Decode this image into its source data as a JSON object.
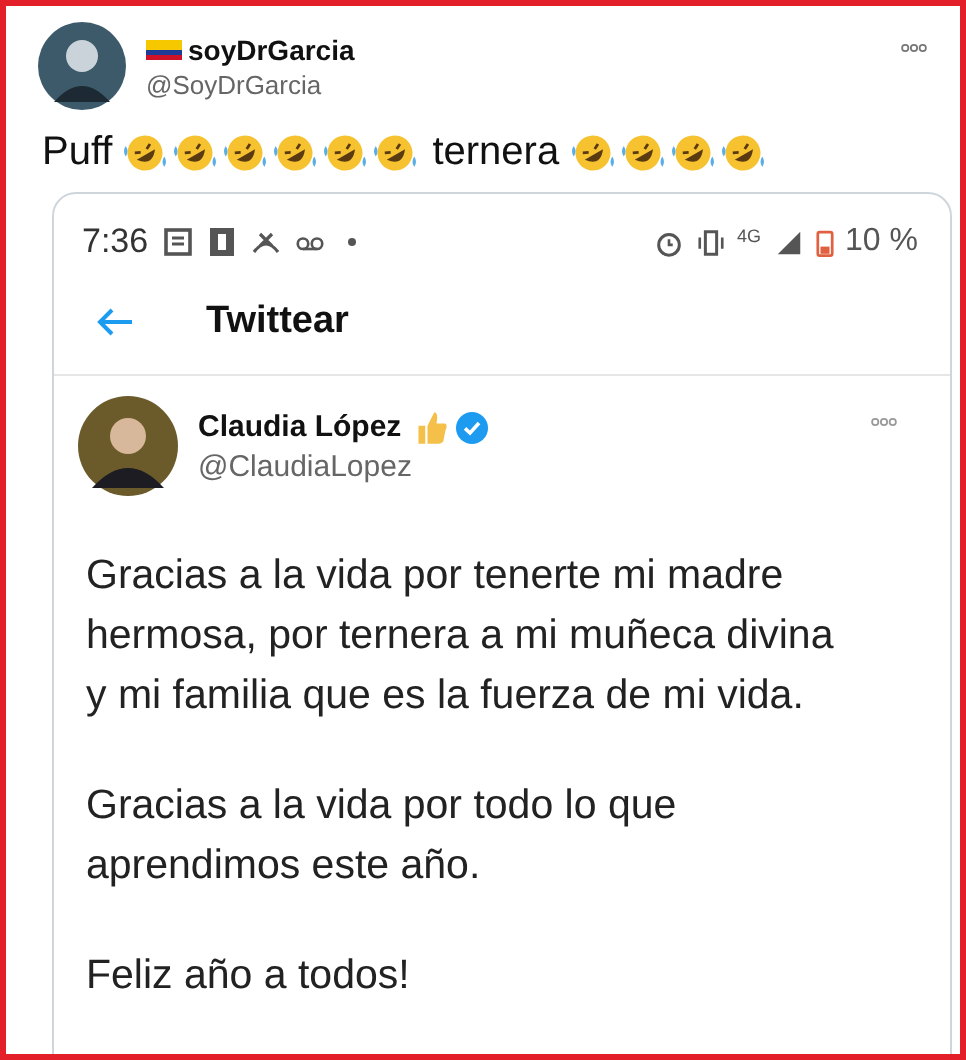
{
  "author": {
    "name": "soyDrGarcia",
    "handle": "@SoyDrGarcia"
  },
  "post_parts": [
    {
      "kind": "text",
      "text": "Puff"
    },
    {
      "kind": "emoji"
    },
    {
      "kind": "emoji"
    },
    {
      "kind": "emoji"
    },
    {
      "kind": "emoji"
    },
    {
      "kind": "emoji"
    },
    {
      "kind": "emoji"
    },
    {
      "kind": "text",
      "text": "ternera"
    },
    {
      "kind": "emoji"
    },
    {
      "kind": "emoji"
    },
    {
      "kind": "emoji"
    },
    {
      "kind": "emoji"
    }
  ],
  "screenshot": {
    "status_bar": {
      "time": "7:36",
      "battery": "10 %",
      "network": "4G"
    },
    "header": {
      "title": "Twittear"
    },
    "tweet": {
      "name": "Claudia López",
      "handle": "@ClaudiaLopez",
      "verified": true,
      "paragraphs": [
        "Gracias a la vida por tenerte mi madre hermosa, por ternera a mi muñeca divina y mi familia que es la fuerza de mi vida.",
        "Gracias a la vida por todo lo que aprendimos este año.",
        "Feliz año a todos!"
      ]
    }
  }
}
